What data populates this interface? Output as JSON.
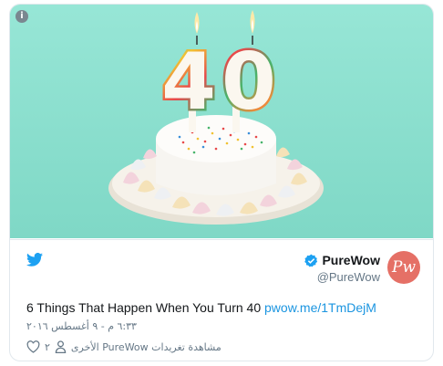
{
  "media": {
    "candle_number": "40",
    "info_glyph": "i",
    "colors": {
      "background": "#8fe3d2",
      "cake": "#fbfaf7",
      "plate": "#f3efe6"
    },
    "icons": [
      "info-icon"
    ]
  },
  "tweet": {
    "display_name": "PureWow",
    "handle": "@PureWow",
    "avatar_text": "Pw",
    "text": "6 Things That Happen When You Turn 40 ",
    "link": "pwow.me/1TmDejM",
    "timestamp": "٦:٣٣ م - ٩ أغسطس ٢٠١٦",
    "like_count": "٢",
    "other_tweets_label": "مشاهدة تغريدات PureWow الأخرى",
    "colors": {
      "link": "#1b95e0",
      "bird": "#1da1f2",
      "avatar": "#e57066",
      "verified": "#1da1f2"
    },
    "icons": [
      "twitter-bird-icon",
      "verified-badge-icon",
      "person-icon",
      "heart-icon"
    ]
  }
}
